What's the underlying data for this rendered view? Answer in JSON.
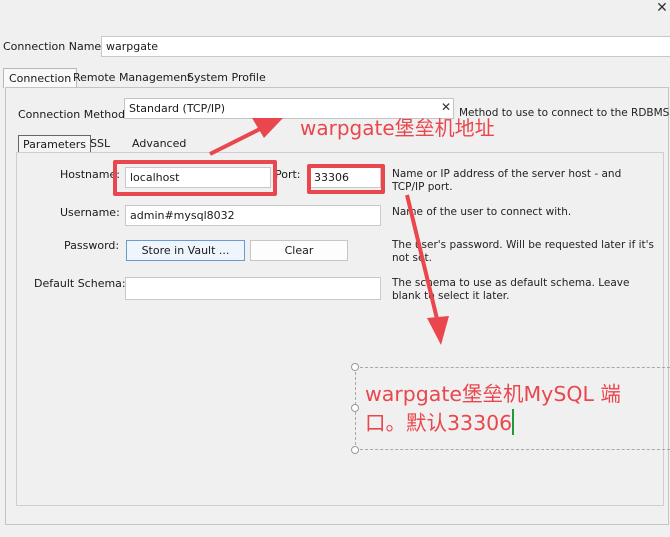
{
  "window": {
    "close_icon": "✕"
  },
  "connection_name": {
    "label": "Connection Name:",
    "value": "warpgate"
  },
  "tabs": [
    {
      "label": "Connection"
    },
    {
      "label": "Remote Management"
    },
    {
      "label": "System Profile"
    }
  ],
  "connection_method": {
    "label": "Connection Method:",
    "value": "Standard (TCP/IP)",
    "help": "Method to use to connect to the RDBMS"
  },
  "subtabs": [
    {
      "label": "Parameters"
    },
    {
      "label": "SSL"
    },
    {
      "label": "Advanced"
    }
  ],
  "hostname": {
    "label": "Hostname:",
    "value": "localhost"
  },
  "port": {
    "label": "Port:",
    "value": "33306"
  },
  "host_help": {
    "line1": "Name or IP address of the server host - and",
    "line2": "TCP/IP port."
  },
  "username": {
    "label": "Username:",
    "value": "admin#mysql8032",
    "help": "Name of the user to connect with."
  },
  "password": {
    "label": "Password:",
    "store_button": "Store in Vault ...",
    "clear_button": "Clear",
    "help_line1": "The user's password. Will be requested later if it's",
    "help_line2": "not set."
  },
  "default_schema": {
    "label": "Default Schema:",
    "value": "",
    "help_line1": "The schema to use as default schema. Leave",
    "help_line2": "blank to select it later."
  },
  "annotations": {
    "host_note": "warpgate堡垒机地址",
    "port_note_line1": "warpgate堡垒机MySQL 端",
    "port_note_line2": "口。默认33306",
    "accent_color": "#e9474d"
  }
}
